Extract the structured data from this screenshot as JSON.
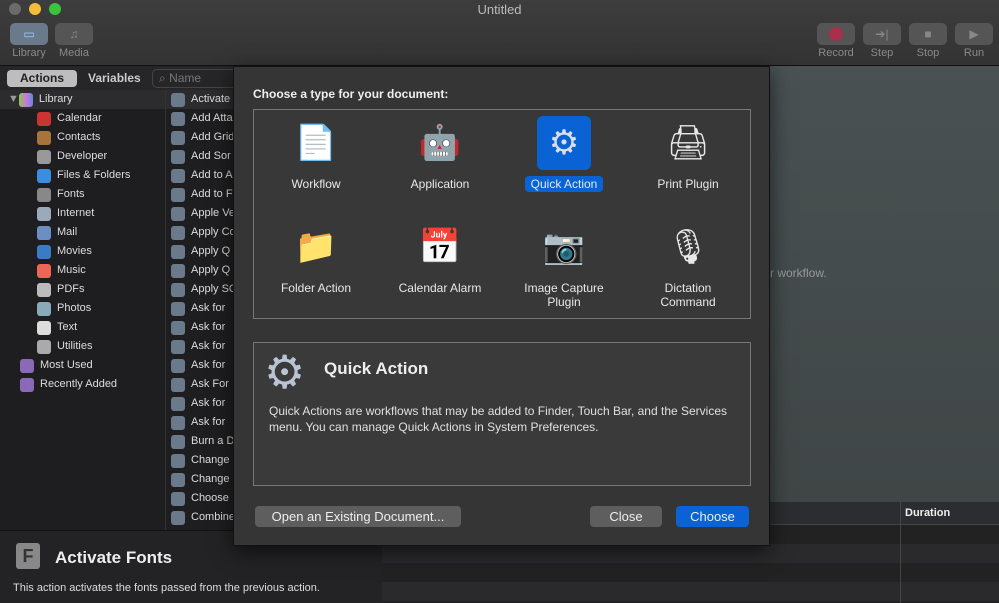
{
  "window": {
    "title": "Untitled"
  },
  "toolbar": {
    "library": "Library",
    "media": "Media",
    "record": "Record",
    "step": "Step",
    "stop": "Stop",
    "run": "Run"
  },
  "library": {
    "tab_actions": "Actions",
    "tab_variables": "Variables",
    "search_placeholder": "Name",
    "categories": [
      "Library",
      "Calendar",
      "Contacts",
      "Developer",
      "Files & Folders",
      "Fonts",
      "Internet",
      "Mail",
      "Movies",
      "Music",
      "PDFs",
      "Photos",
      "Text",
      "Utilities",
      "Most Used",
      "Recently Added"
    ],
    "actions": [
      "Activate",
      "Add Atta",
      "Add Grid",
      "Add Sor",
      "Add to A",
      "Add to F",
      "Apple Ve",
      "Apply Co",
      "Apply Q",
      "Apply Q",
      "Apply SQ",
      "Ask for",
      "Ask for",
      "Ask for",
      "Ask for",
      "Ask For",
      "Ask for",
      "Ask for",
      "Burn a D",
      "Change",
      "Change",
      "Choose",
      "Combine"
    ]
  },
  "description": {
    "title": "Activate Fonts",
    "text": "This action activates the fonts passed from the previous action."
  },
  "canvas": {
    "hint": "r workflow."
  },
  "log": {
    "duration_header": "Duration"
  },
  "dialog": {
    "prompt": "Choose a type for your document:",
    "types": [
      {
        "label": "Workflow",
        "icon": "workflow-icon",
        "sym": "📄"
      },
      {
        "label": "Application",
        "icon": "application-icon",
        "sym": "🤖"
      },
      {
        "label": "Quick Action",
        "icon": "gear-icon",
        "sym": "⚙"
      },
      {
        "label": "Print Plugin",
        "icon": "printer-icon",
        "sym": "🖨"
      },
      {
        "label": "Folder Action",
        "icon": "folder-icon",
        "sym": "📁"
      },
      {
        "label": "Calendar Alarm",
        "icon": "calendar-icon",
        "sym": "📅"
      },
      {
        "label": "Image Capture Plugin",
        "icon": "camera-icon",
        "sym": "📷"
      },
      {
        "label": "Dictation Command",
        "icon": "microphone-icon",
        "sym": "🎙"
      }
    ],
    "selected": "Quick Action",
    "info_title": "Quick Action",
    "info_text": "Quick Actions are workflows that may be added to Finder, Touch Bar, and the Services menu. You can manage Quick Actions in System Preferences.",
    "open_existing": "Open an Existing Document...",
    "close": "Close",
    "choose": "Choose"
  },
  "colors": {
    "accent": "#0a63d4",
    "record": "#c0324a"
  }
}
